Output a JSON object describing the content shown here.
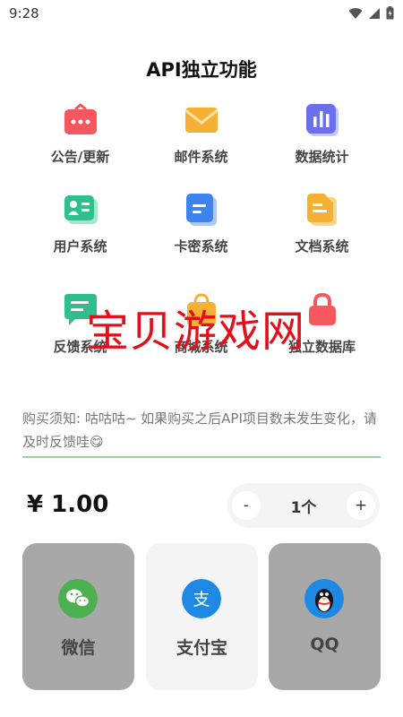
{
  "status_bar": {
    "time": "9:28"
  },
  "page_title": "API独立功能",
  "features": [
    {
      "label": "公告/更新",
      "icon": "announcement-icon",
      "color": "#f4575e"
    },
    {
      "label": "邮件系统",
      "icon": "mail-icon",
      "color": "#f6b033"
    },
    {
      "label": "数据统计",
      "icon": "statistics-icon",
      "color": "#6a6ff0"
    },
    {
      "label": "用户系统",
      "icon": "user-card-icon",
      "color": "#2fbf8a"
    },
    {
      "label": "卡密系统",
      "icon": "card-document-icon",
      "color": "#3d84f2"
    },
    {
      "label": "文档系统",
      "icon": "document-icon",
      "color": "#f6b033"
    },
    {
      "label": "反馈系统",
      "icon": "feedback-icon",
      "color": "#2fbf8a"
    },
    {
      "label": "商城系统",
      "icon": "shop-bag-icon",
      "color": "#f6b033"
    },
    {
      "label": "独立数据库",
      "icon": "database-lock-icon",
      "color": "#f4575e"
    }
  ],
  "watermark": "宝贝游戏网",
  "notice": "购买须知: 咕咕咕~ 如果购买之后API项目数未发生变化，请及时反馈哇😋",
  "price": "¥ 1.00",
  "quantity": {
    "minus": "-",
    "value": "1个",
    "plus": "+"
  },
  "payment_methods": [
    {
      "label": "微信",
      "icon": "wechat-icon",
      "color": "#4caf50"
    },
    {
      "label": "支付宝",
      "icon": "alipay-icon",
      "color": "#1e88e5"
    },
    {
      "label": "QQ",
      "icon": "qq-penguin-icon",
      "color": "#1e88e5"
    }
  ]
}
